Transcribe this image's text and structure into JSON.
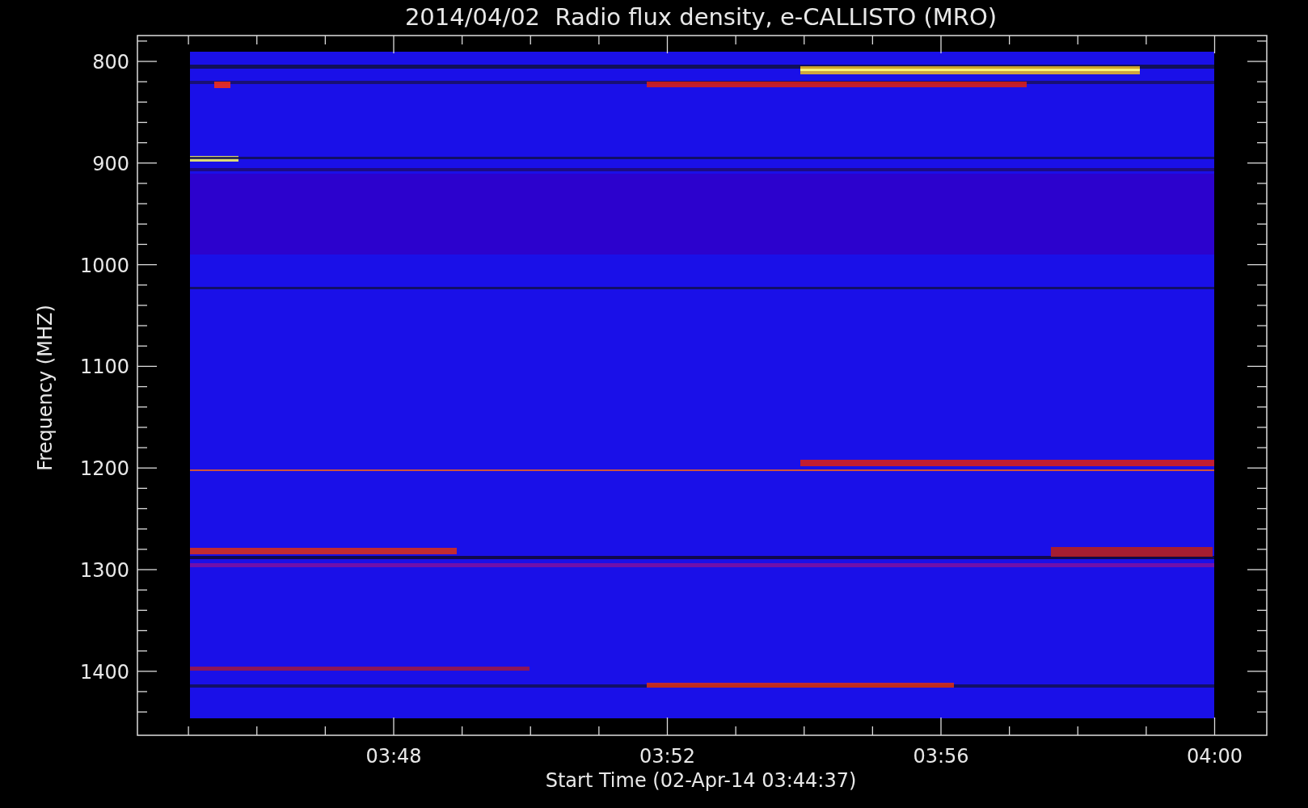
{
  "title": "2014/04/02  Radio flux density, e-CALLISTO (MRO)",
  "y_axis": {
    "label": "Frequency (MHZ)",
    "ticks": [
      "800",
      "900",
      "1000",
      "1100",
      "1200",
      "1300",
      "1400"
    ]
  },
  "x_axis": {
    "label": "Start Time (02-Apr-14 03:44:37)",
    "ticks": [
      "03:48",
      "03:52",
      "03:56",
      "04:00"
    ]
  }
}
